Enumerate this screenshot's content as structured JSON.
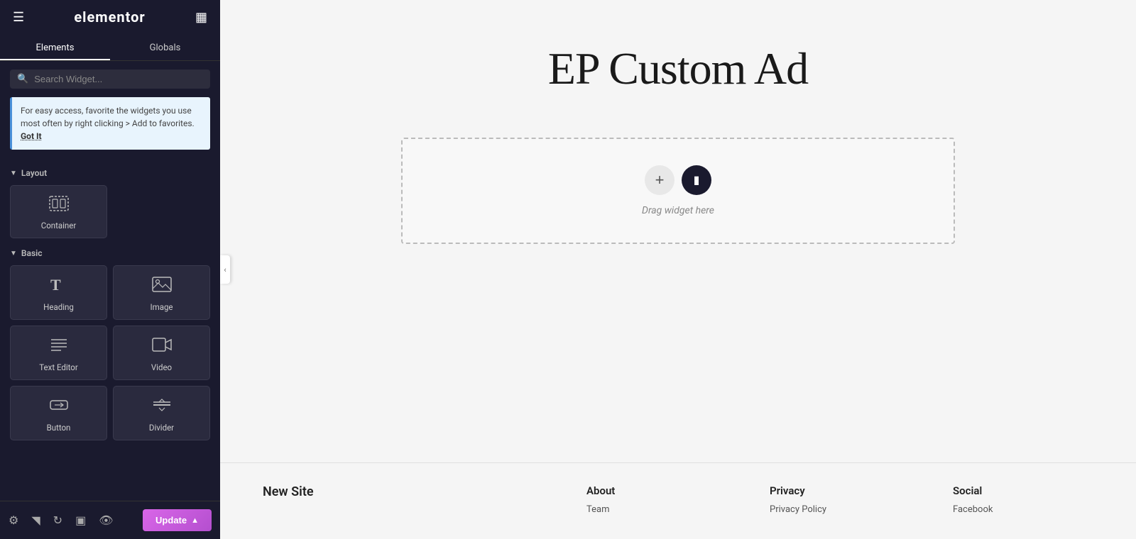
{
  "sidebar": {
    "logo": "elementor",
    "tabs": [
      {
        "id": "elements",
        "label": "Elements",
        "active": true
      },
      {
        "id": "globals",
        "label": "Globals",
        "active": false
      }
    ],
    "search": {
      "placeholder": "Search Widget..."
    },
    "tip": {
      "text": "For easy access, favorite the widgets you use most often by right clicking > Add to favorites.",
      "action_label": "Got It"
    },
    "sections": [
      {
        "id": "layout",
        "label": "Layout",
        "widgets": [
          {
            "id": "container",
            "label": "Container",
            "icon": "container"
          }
        ]
      },
      {
        "id": "basic",
        "label": "Basic",
        "widgets": [
          {
            "id": "heading",
            "label": "Heading",
            "icon": "heading"
          },
          {
            "id": "image",
            "label": "Image",
            "icon": "image"
          },
          {
            "id": "text-editor",
            "label": "Text Editor",
            "icon": "text-editor"
          },
          {
            "id": "video",
            "label": "Video",
            "icon": "video"
          },
          {
            "id": "button",
            "label": "Button",
            "icon": "button"
          },
          {
            "id": "divider",
            "label": "Divider",
            "icon": "divider"
          }
        ]
      }
    ],
    "bottom": {
      "icons": [
        "settings",
        "layers",
        "history",
        "navigator",
        "preview"
      ],
      "update_label": "Update"
    }
  },
  "canvas": {
    "page_title": "EP Custom Ad",
    "drop_zone_label": "Drag widget here",
    "drop_btn_plus": "+",
    "drop_btn_folder": "▪"
  },
  "footer": {
    "brand": "New Site",
    "columns": [
      {
        "title": "About",
        "items": [
          "Team"
        ]
      },
      {
        "title": "Privacy",
        "items": [
          "Privacy Policy"
        ]
      },
      {
        "title": "Social",
        "items": [
          "Facebook"
        ]
      }
    ]
  }
}
